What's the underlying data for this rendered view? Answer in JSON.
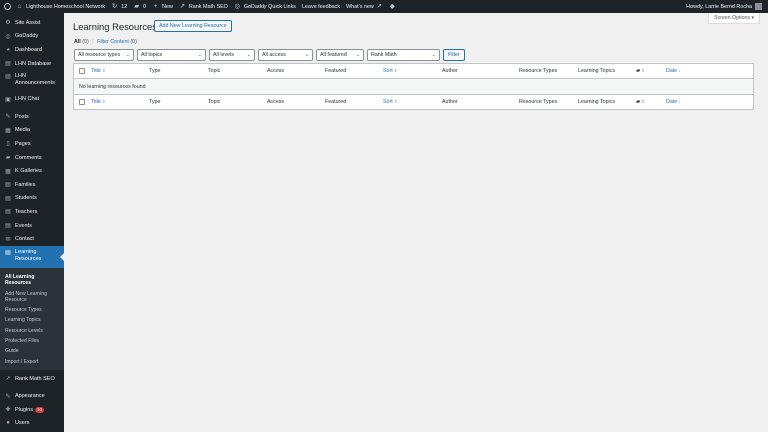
{
  "admin_bar": {
    "site_name": "Lighthouse Homeschool Network",
    "updates_count": "12",
    "comments_count": "0",
    "new_label": "New",
    "rank_math": "Rank Math SEO",
    "godaddy_links": "GoDaddy Quick Links",
    "feedback": "Leave feedback",
    "whats_new": "What's new",
    "howdy": "Howdy, Larrie Bernd Rocha"
  },
  "sidebar": {
    "items": [
      {
        "label": "Site Assist",
        "icon": "gear-icon",
        "glyph": "⚙"
      },
      {
        "label": "GoDaddy",
        "icon": "godaddy-icon",
        "glyph": "◎"
      },
      {
        "label": "Dashboard",
        "icon": "dashboard-icon",
        "glyph": "◕"
      },
      {
        "label": "LHN Database",
        "icon": "database-icon",
        "glyph": "▤"
      },
      {
        "label": "LHN Announcements",
        "icon": "megaphone-icon",
        "glyph": "▤"
      },
      {
        "label": "LHN Chat",
        "icon": "chat-icon",
        "glyph": "▣"
      },
      {
        "label": "Posts",
        "icon": "pin-icon",
        "glyph": "✎"
      },
      {
        "label": "Media",
        "icon": "media-icon",
        "glyph": "▦"
      },
      {
        "label": "Pages",
        "icon": "pages-icon",
        "glyph": "▯"
      },
      {
        "label": "Comments",
        "icon": "comment-icon",
        "glyph": "▰"
      },
      {
        "label": "K Galleries",
        "icon": "gallery-icon",
        "glyph": "▦"
      },
      {
        "label": "Families",
        "icon": "families-icon",
        "glyph": "▤"
      },
      {
        "label": "Students",
        "icon": "students-icon",
        "glyph": "▤"
      },
      {
        "label": "Teachers",
        "icon": "teachers-icon",
        "glyph": "▤"
      },
      {
        "label": "Events",
        "icon": "events-icon",
        "glyph": "▤"
      },
      {
        "label": "Contact",
        "icon": "contact-icon",
        "glyph": "✉"
      },
      {
        "label": "Learning Resources",
        "icon": "book-icon",
        "glyph": "▤"
      },
      {
        "label": "Rank Math SEO",
        "icon": "rankmath-icon",
        "glyph": "↗"
      },
      {
        "label": "Appearance",
        "icon": "brush-icon",
        "glyph": "✎"
      },
      {
        "label": "Plugins",
        "icon": "plugin-icon",
        "glyph": "✚"
      },
      {
        "label": "Users",
        "icon": "users-icon",
        "glyph": "●"
      }
    ],
    "plugins_badge": "10",
    "submenu": [
      "All Learning Resources",
      "Add New Learning Resource",
      "Resource Types",
      "Learning Topics",
      "Resource Levels",
      "Protected Files",
      "Guide",
      "Import / Export"
    ]
  },
  "page": {
    "title": "Learning Resources",
    "add_new": "Add New Learning Resource",
    "screen_options": "Screen Options",
    "views": {
      "all_label": "All",
      "all_count": "(0)",
      "separator": "|",
      "filter_label": "Filter Content",
      "filter_count": "(0)"
    },
    "filters": [
      "All resource types",
      "All topics",
      "All levels",
      "All access",
      "All featured",
      "Rank Math"
    ],
    "filter_button": "Filter"
  },
  "table": {
    "columns": {
      "title": "Title",
      "type": "Type",
      "topic": "Topic",
      "access": "Access",
      "featured": "Featured",
      "sort": "Sort",
      "author": "Author",
      "resource_types": "Resource Types",
      "learning_topics": "Learning Topics",
      "date": "Date"
    },
    "empty_message": "No learning resources found"
  },
  "colors": {
    "accent": "#2271b1",
    "sidebar_bg": "#1d2327",
    "badge": "#d63638"
  }
}
